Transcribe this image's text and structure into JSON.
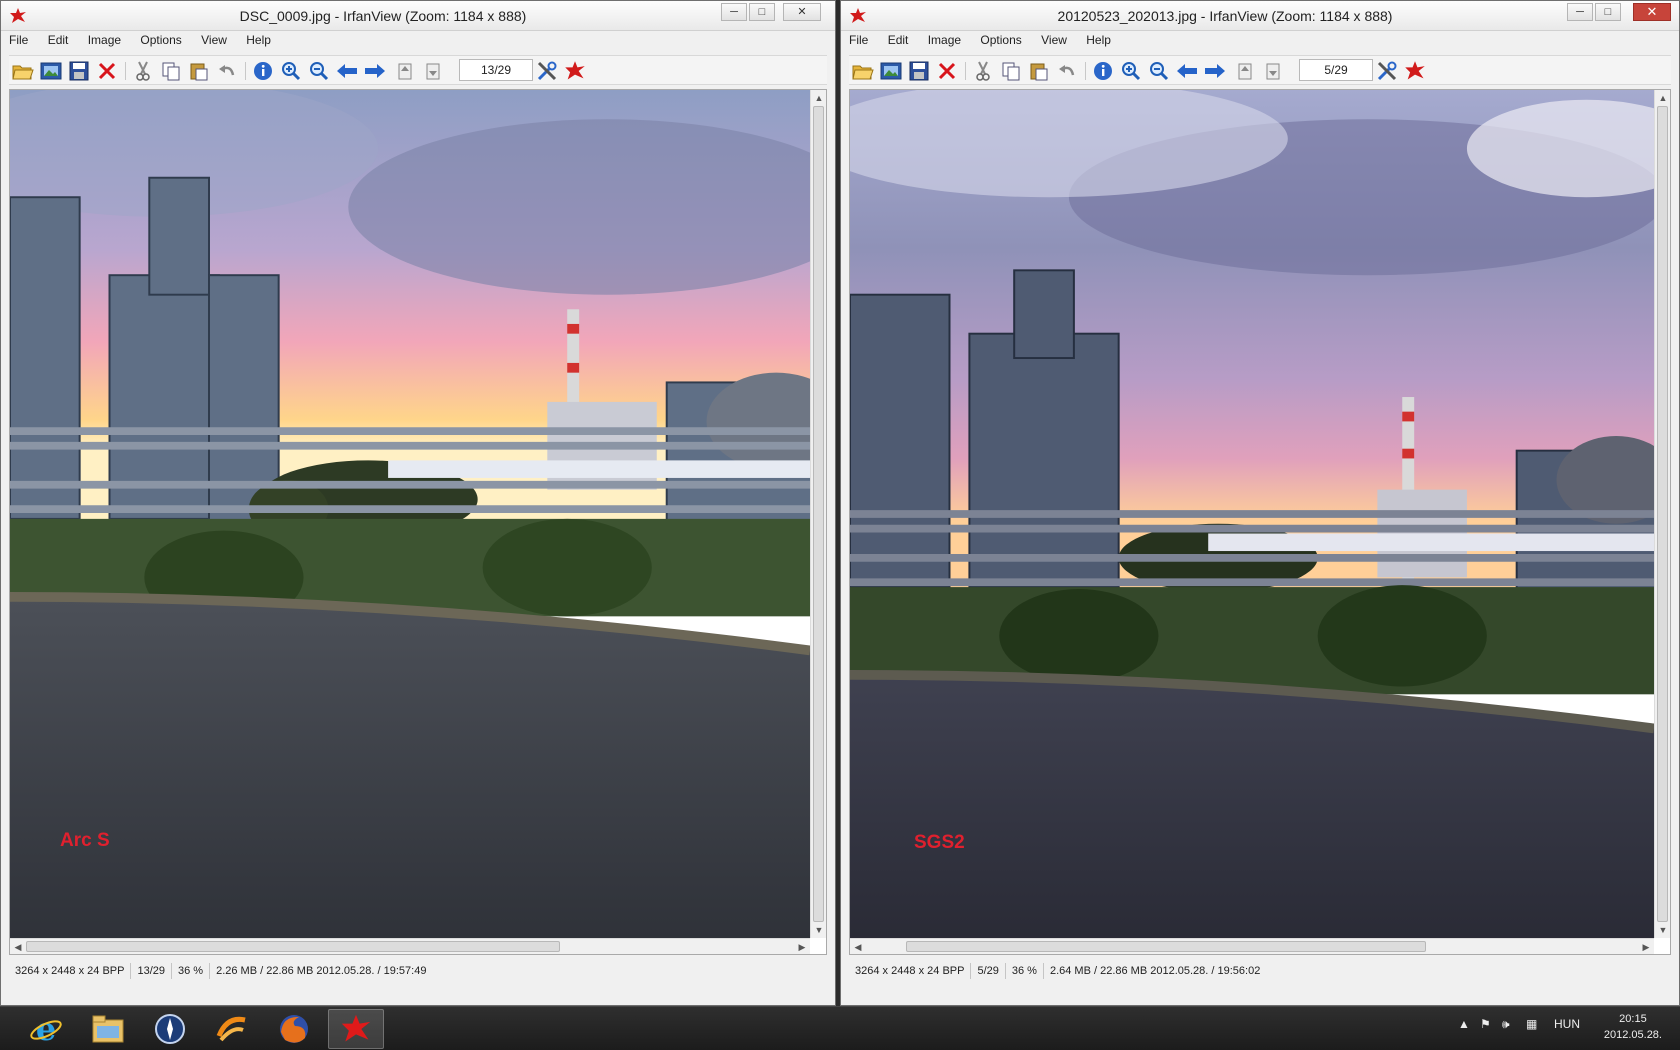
{
  "left_window": {
    "title": "DSC_0009.jpg - IrfanView (Zoom: 1184 x 888)",
    "menu": [
      "File",
      "Edit",
      "Image",
      "Options",
      "View",
      "Help"
    ],
    "page_counter": "13/29",
    "overlay_label": "Arc S",
    "status": {
      "dimensions": "3264 x 2448 x 24 BPP",
      "index": "13/29",
      "zoom": "36 %",
      "size_date": "2.26 MB / 22.86 MB 2012.05.28. / 19:57:49"
    }
  },
  "right_window": {
    "title": "20120523_202013.jpg - IrfanView (Zoom: 1184 x 888)",
    "menu": [
      "File",
      "Edit",
      "Image",
      "Options",
      "View",
      "Help"
    ],
    "page_counter": "5/29",
    "overlay_label": "SGS2",
    "status": {
      "dimensions": "3264 x 2448 x 24 BPP",
      "index": "5/29",
      "zoom": "36 %",
      "size_date": "2.64 MB / 22.86 MB 2012.05.28. / 19:56:02"
    }
  },
  "window_controls": {
    "minimize": "─",
    "maximize": "□",
    "close": "✕"
  },
  "toolbar_icons": [
    "open-icon",
    "slideshow-icon",
    "save-icon",
    "delete-icon",
    "cut-icon",
    "copy-icon",
    "paste-icon",
    "undo-icon",
    "info-icon",
    "zoom-in-icon",
    "zoom-out-icon",
    "previous-icon",
    "next-icon",
    "first-page-icon",
    "next-page-icon",
    "properties-icon",
    "irfanview-icon"
  ],
  "taskbar": {
    "apps": [
      "internet-explorer-icon",
      "file-explorer-icon",
      "compass-app-icon",
      "mobile-app-icon",
      "firefox-icon",
      "irfanview-icon"
    ],
    "language": "HUN",
    "time": "20:15",
    "date": "2012.05.28."
  },
  "colors": {
    "overlay_text": "#e0202e",
    "taskbar": "#1c1c1c"
  }
}
